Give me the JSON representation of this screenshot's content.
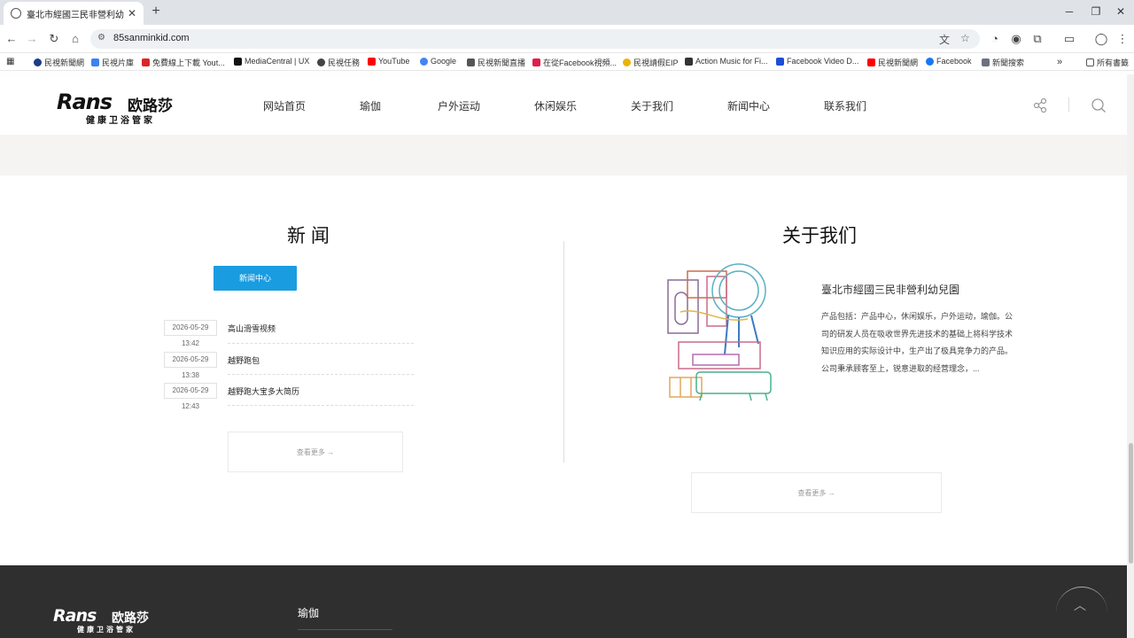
{
  "browser": {
    "tab_title": "臺北市經國三民非營利幼兒園",
    "tab_close": "✕",
    "new_tab": "+",
    "url": "85sanminkid.com",
    "all_bookmarks": "所有書籤",
    "bookmarks": [
      "民視新聞網",
      "民視片庫",
      "免費線上下載 Yout...",
      "MediaCentral | UX",
      "民視任務",
      "YouTube",
      "Google",
      "民視新聞直播",
      "在從Facebook視頻...",
      "民視請假EIP",
      "Action Music for Fi...",
      "Facebook Video D...",
      "民視新聞網",
      "Facebook",
      "新聞搜索"
    ]
  },
  "site": {
    "logo_text": "Rans",
    "logo_cn": "欧路莎",
    "logo_tagline": "健康卫浴管家",
    "nav": [
      "网站首页",
      "瑜伽",
      "户外运动",
      "休闲娱乐",
      "关于我们",
      "新闻中心",
      "联系我们"
    ]
  },
  "news": {
    "title": "新 闻",
    "button": "新闻中心",
    "items": [
      {
        "date": "2026-05-29",
        "time": "13:42",
        "title": "高山滑雪视频"
      },
      {
        "date": "2026-05-29",
        "time": "13:38",
        "title": "越野跑包"
      },
      {
        "date": "2026-05-29",
        "time": "12:43",
        "title": "越野跑大宝多大简历"
      }
    ],
    "more": "查看更多  →"
  },
  "about": {
    "title": "关于我们",
    "name": "臺北市經國三民非營利幼兒園",
    "desc": "产品包括：产品中心，休闲娱乐，户外运动，瑜伽。公司的研发人员在吸收世界先进技术的基础上将科学技术知识应用的实际设计中，生产出了极具竞争力的产品。公司秉承顾客至上，锐意进取的经营理念，...",
    "more": "查看更多  →"
  },
  "footer": {
    "logo_text": "Rans",
    "logo_cn": "欧路莎",
    "logo_tagline": "健康卫浴管家",
    "link": "瑜伽",
    "back_top": "︿"
  },
  "colors": {
    "accent": "#1a9ce0",
    "footer": "#2f2f2f"
  }
}
